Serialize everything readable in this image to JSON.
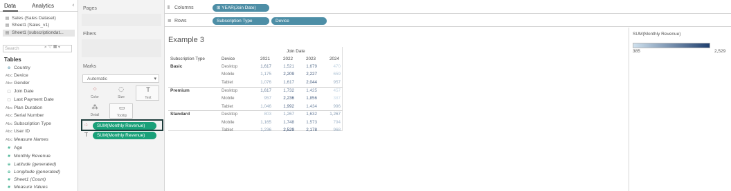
{
  "data_pane": {
    "tabs": [
      {
        "label": "Data"
      },
      {
        "label": "Analytics"
      }
    ],
    "collapse_icon": "chevron-left-icon",
    "datasources": [
      {
        "label": "Sales (Sales Dataset)",
        "icon": "datasource-icon"
      },
      {
        "label": "Sheet1 (Sales_v1)",
        "icon": "datasource-icon"
      },
      {
        "label": "Sheet1 (subscriptiondat...",
        "icon": "datasource-icon",
        "selected": true
      }
    ],
    "search_placeholder": "Search",
    "tables_heading": "Tables",
    "fields": [
      {
        "label": "Country",
        "icon": "globe-icon"
      },
      {
        "label": "Device",
        "icon": "abc-icon"
      },
      {
        "label": "Gender",
        "icon": "abc-icon"
      },
      {
        "label": "Join Date",
        "icon": "calendar-icon"
      },
      {
        "label": "Last Payment Date",
        "icon": "calendar-icon"
      },
      {
        "label": "Plan Duration",
        "icon": "abc-icon"
      },
      {
        "label": "Serial Number",
        "icon": "abc-icon"
      },
      {
        "label": "Subscription Type",
        "icon": "abc-icon"
      },
      {
        "label": "User ID",
        "icon": "abc-icon"
      },
      {
        "label": "Measure Names",
        "icon": "abc-icon",
        "italic": true
      },
      {
        "label": "Age",
        "icon": "measure-icon"
      },
      {
        "label": "Monthly Revenue",
        "icon": "measure-icon"
      },
      {
        "label": "Latitude (generated)",
        "icon": "globe-icon",
        "italic": true
      },
      {
        "label": "Longitude (generated)",
        "icon": "globe-icon",
        "italic": true
      },
      {
        "label": "Sheet1 (Count)",
        "icon": "measure-icon",
        "italic": true
      },
      {
        "label": "Measure Values",
        "icon": "measure-icon",
        "italic": true
      }
    ]
  },
  "cards": {
    "pages": "Pages",
    "filters": "Filters",
    "marks": "Marks",
    "marks_type": "Automatic",
    "mark_buttons": [
      {
        "label": "Color",
        "icon": "color-icon"
      },
      {
        "label": "Size",
        "icon": "size-icon"
      },
      {
        "label": "Text",
        "icon": "text-icon"
      },
      {
        "label": "Detail",
        "icon": "detail-icon"
      },
      {
        "label": "Tooltip",
        "icon": "tooltip-icon"
      }
    ],
    "mark_pills": [
      "SUM(Monthly Revenue)",
      "SUM(Monthly Revenue)"
    ]
  },
  "shelves": {
    "columns_label": "Columns",
    "columns_pills": [
      "YEAR(Join Date)"
    ],
    "rows_label": "Rows",
    "rows_pills": [
      "Subscription Type",
      "Device"
    ]
  },
  "sheet": {
    "title": "Example 3",
    "col_header_group": "Join Date",
    "row_headers": [
      "Subscription Type",
      "Device"
    ],
    "years": [
      "2021",
      "2022",
      "2023",
      "2024"
    ],
    "groups": [
      {
        "name": "Basic",
        "rows": [
          {
            "device": "Desktop",
            "values": [
              "1,617",
              "1,521",
              "1,679",
              "470"
            ]
          },
          {
            "device": "Mobile",
            "values": [
              "1,175",
              "2,209",
              "2,227",
              "659"
            ]
          },
          {
            "device": "Tablet",
            "values": [
              "1,076",
              "1,617",
              "2,044",
              "957"
            ]
          }
        ]
      },
      {
        "name": "Premium",
        "rows": [
          {
            "device": "Desktop",
            "values": [
              "1,617",
              "1,732",
              "1,425",
              "457"
            ]
          },
          {
            "device": "Mobile",
            "values": [
              "957",
              "2,236",
              "1,856",
              "387"
            ]
          },
          {
            "device": "Tablet",
            "values": [
              "1,046",
              "1,992",
              "1,434",
              "996"
            ]
          }
        ]
      },
      {
        "name": "Standard",
        "rows": [
          {
            "device": "Desktop",
            "values": [
              "803",
              "1,267",
              "1,632",
              "1,267"
            ]
          },
          {
            "device": "Mobile",
            "values": [
              "1,165",
              "1,748",
              "1,573",
              "794"
            ]
          },
          {
            "device": "Tablet",
            "values": [
              "1,236",
              "2,529",
              "2,178",
              "968"
            ]
          }
        ]
      }
    ]
  },
  "legend": {
    "title": "SUM(Monthly Revenue)",
    "min": "385",
    "max": "2,529",
    "color_low": "#cfe1ee",
    "color_high": "#1f3f6e"
  },
  "colors": {
    "pill_green": "#1aa079",
    "pill_blue": "#4d8ea6",
    "highlight_border": "#1d3b3a"
  }
}
